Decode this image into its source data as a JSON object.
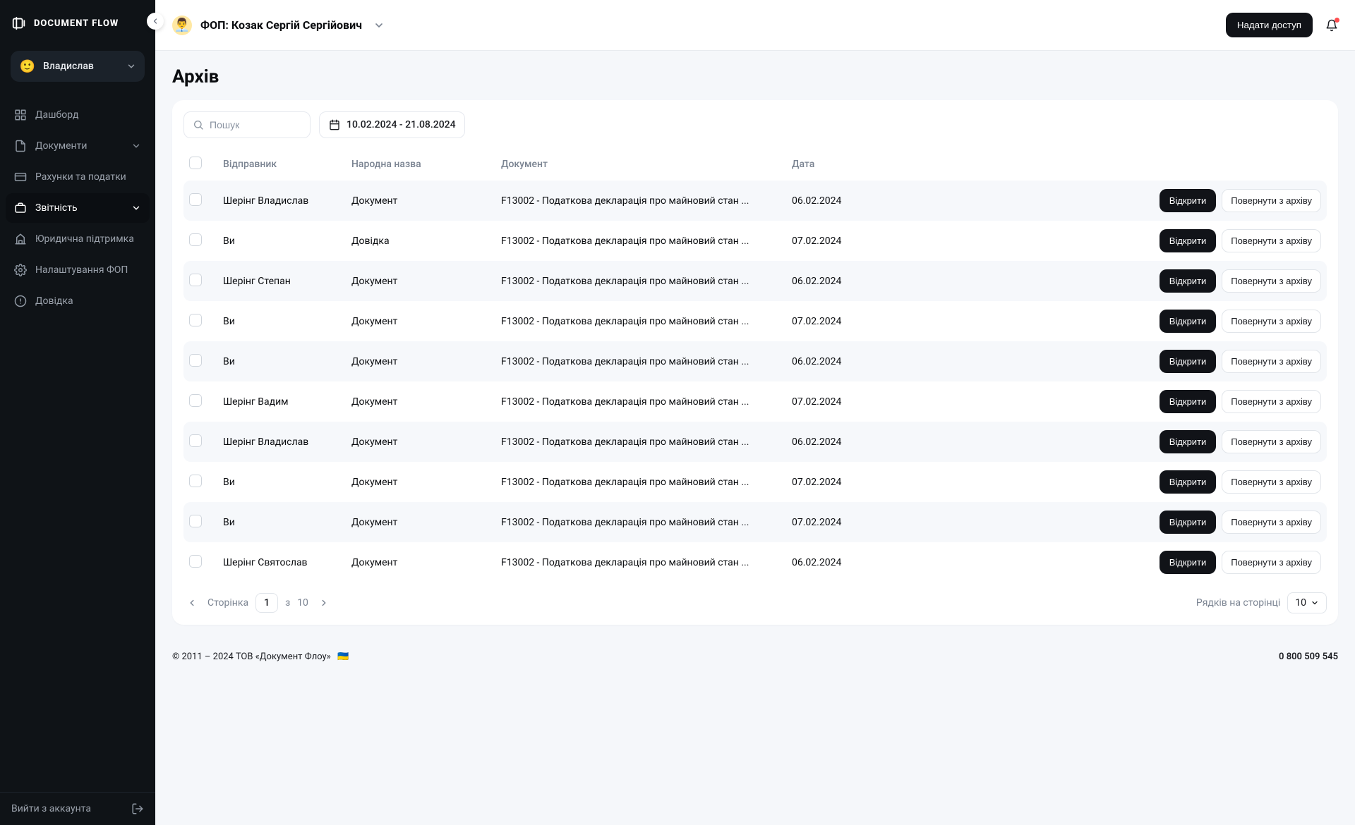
{
  "brand": "DOCUMENT FLOW",
  "user": {
    "emoji": "🙂",
    "name": "Владислав"
  },
  "sidebar": {
    "items": [
      {
        "key": "dashboard",
        "label": "Дашборд",
        "hasChevron": false
      },
      {
        "key": "documents",
        "label": "Документи",
        "hasChevron": true
      },
      {
        "key": "invoices",
        "label": "Рахунки та податки",
        "hasChevron": false
      },
      {
        "key": "reports",
        "label": "Звітність",
        "hasChevron": true,
        "active": true
      },
      {
        "key": "legal",
        "label": "Юридична підтримка",
        "hasChevron": false
      },
      {
        "key": "settings",
        "label": "Налаштування ФОП",
        "hasChevron": false
      },
      {
        "key": "help",
        "label": "Довідка",
        "hasChevron": false
      }
    ],
    "logout": "Вийти з аккаунта"
  },
  "topbar": {
    "org_emoji": "👨‍💼",
    "org_title": "ФОП: Козак Сергій Сергійович",
    "grant_access": "Надати доступ"
  },
  "page": {
    "title": "Архів"
  },
  "filters": {
    "search_placeholder": "Пошук",
    "date_range": "10.02.2024 - 21.08.2024"
  },
  "table": {
    "headers": {
      "sender": "Відправник",
      "name": "Народна назва",
      "document": "Документ",
      "date": "Дата"
    },
    "actions": {
      "open": "Відкрити",
      "restore": "Повернути з архіву"
    },
    "rows": [
      {
        "sender": "Шерінг Владислав",
        "name": "Документ",
        "document": "F13002 - Податкова декларація про майновий стан ...",
        "date": "06.02.2024"
      },
      {
        "sender": "Ви",
        "name": "Довідка",
        "document": "F13002 - Податкова декларація про майновий стан ...",
        "date": "07.02.2024"
      },
      {
        "sender": "Шерінг Степан",
        "name": "Документ",
        "document": "F13002 - Податкова декларація про майновий стан ...",
        "date": "06.02.2024"
      },
      {
        "sender": "Ви",
        "name": "Документ",
        "document": "F13002 - Податкова декларація про майновий стан ...",
        "date": "07.02.2024"
      },
      {
        "sender": "Ви",
        "name": "Документ",
        "document": "F13002 - Податкова декларація про майновий стан ...",
        "date": "06.02.2024"
      },
      {
        "sender": "Шерінг Вадим",
        "name": "Документ",
        "document": "F13002 - Податкова декларація про майновий стан ...",
        "date": "07.02.2024"
      },
      {
        "sender": "Шерінг Владислав",
        "name": "Документ",
        "document": "F13002 - Податкова декларація про майновий стан ...",
        "date": "06.02.2024"
      },
      {
        "sender": "Ви",
        "name": "Документ",
        "document": "F13002 - Податкова декларація про майновий стан ...",
        "date": "07.02.2024"
      },
      {
        "sender": "Ви",
        "name": "Документ",
        "document": "F13002 - Податкова декларація про майновий стан ...",
        "date": "07.02.2024"
      },
      {
        "sender": "Шерінг Святослав",
        "name": "Документ",
        "document": "F13002 - Податкова декларація про майновий стан ...",
        "date": "06.02.2024"
      }
    ]
  },
  "pagination": {
    "label": "Сторінка",
    "page": "1",
    "of_sep": "з",
    "total": "10",
    "rows_label": "Рядків на сторінці",
    "rows_value": "10"
  },
  "footer": {
    "copyright": "© 2011 – 2024 ТОВ «Документ Флоу»",
    "flag": "🇺🇦",
    "phone": "0 800 509 545"
  }
}
